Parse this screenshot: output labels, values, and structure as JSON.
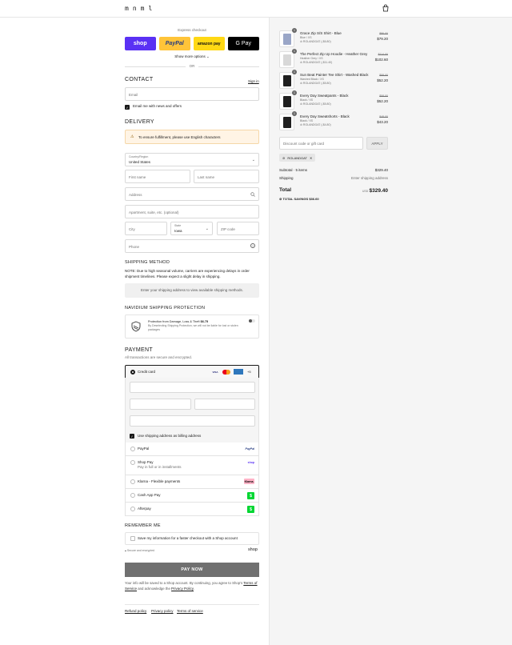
{
  "header": {
    "logo": "mnml",
    "bag_icon": "shopping-bag-icon"
  },
  "express": {
    "label": "Express checkout",
    "buttons": [
      "shop",
      "PayPal",
      "amazon pay",
      "G Pay"
    ],
    "more_options": "Show more options ⌄",
    "or": "OR"
  },
  "contact": {
    "title": "CONTACT",
    "sign_in": "Sign in",
    "email_placeholder": "Email",
    "email_news": "Email me with news and offers"
  },
  "delivery": {
    "title": "DELIVERY",
    "notice": "To ensure fulfillment, please use English characters",
    "country_label": "Country/Region",
    "country_value": "United States",
    "first_name": "First name",
    "last_name": "Last name",
    "address": "Address",
    "apartment": "Apartment, suite, etc. (optional)",
    "city": "City",
    "state_label": "State",
    "state_value": "Iowa",
    "zip": "ZIP code",
    "phone": "Phone"
  },
  "shipping": {
    "title": "SHIPPING METHOD",
    "note": "NOTE: Due to high seasonal volume, carriers are experiencing delays in order shipment timelines. Please expect a slight delay in shipping.",
    "placeholder": "Enter your shipping address to view available shipping methods."
  },
  "protection": {
    "title": "NAVIDIUM SHIPPING PROTECTION",
    "line1": "Protection from Damage, Loss & Theft",
    "price": "$6.75",
    "line2": "By Deselecting Shipping Protection, we will not be liable for lost or stolen packages"
  },
  "payment": {
    "title": "PAYMENT",
    "subtitle": "All transactions are secure and encrypted.",
    "credit_card": "Credit card",
    "card_badges": [
      "VISA",
      "MC",
      "AMEX",
      "+5"
    ],
    "billing_same": "Use shipping address as billing address",
    "methods": [
      {
        "label": "PayPal",
        "sub": "",
        "badge": "PayPal",
        "color": "#253b80"
      },
      {
        "label": "Shop Pay",
        "sub": "Pay in full or in installments",
        "badge": "shop",
        "color": "#5a31f4"
      },
      {
        "label": "Klarna - Flexible payments",
        "sub": "",
        "badge": "Klarna.",
        "color": "#ffb3c7"
      },
      {
        "label": "Cash App Pay",
        "sub": "",
        "badge": "$",
        "color": "#00d632"
      },
      {
        "label": "Afterpay",
        "sub": "",
        "badge": "$",
        "color": "#00d632"
      }
    ]
  },
  "remember": {
    "title": "REMEMBER ME",
    "save_info": "Save my information for a faster checkout with a Shop account",
    "secure": "Secure and encrypted",
    "shop": "shop"
  },
  "pay_now": "PAY NOW",
  "legal": {
    "prefix": "Your info will be saved to a Shop account. By continuing, you agree to Shop's",
    "terms": "Terms of Service",
    "middle": "and acknowledge the",
    "privacy": "Privacy Policy"
  },
  "footer_links": [
    "Refund policy",
    "Privacy policy",
    "Terms of service"
  ],
  "cart": {
    "items": [
      {
        "qty": "1",
        "name": "Grace Zip S/S Shirt - Blue",
        "variant": "Blue / XS",
        "discount": "ROLANDGAT (-$6.80)",
        "old": "$86.00",
        "price": "$79.20",
        "thumb": "#9aa6c7"
      },
      {
        "qty": "1",
        "name": "The Perfect Zip Up Hoodie - Heather Grey",
        "variant": "Heather Grey / XS",
        "discount": "ROLANDGAT (-$11.40)",
        "old": "$114.00",
        "price": "$102.60",
        "thumb": "#d8d8d8"
      },
      {
        "qty": "1",
        "name": "Sun Beat Painter Tee Shirt - Washed Black",
        "variant": "Washed Black / XS",
        "discount": "ROLANDGAT (-$5.80)",
        "old": "$58.00",
        "price": "$52.20",
        "thumb": "#1f1f1f"
      },
      {
        "qty": "1",
        "name": "Every Day Sweatpants - Black",
        "variant": "Black / XS",
        "discount": "ROLANDGAT (-$5.80)",
        "old": "$58.00",
        "price": "$52.20",
        "thumb": "#1f1f1f"
      },
      {
        "qty": "1",
        "name": "Every Day Sweatshorts - Black",
        "variant": "Black / XS",
        "discount": "ROLANDGAT (-$4.80)",
        "old": "$48.00",
        "price": "$43.20",
        "thumb": "#1f1f1f"
      }
    ],
    "discount_placeholder": "Discount code or gift card",
    "apply": "APPLY",
    "applied_code": "ROLANDGAT",
    "subtotal_label": "Subtotal · 5 items",
    "subtotal": "$329.40",
    "shipping_label": "Shipping",
    "shipping_value": "Enter shipping address",
    "total_label": "Total",
    "currency": "USD",
    "total": "$329.40",
    "savings_label": "TOTAL SAVINGS",
    "savings": "$36.60"
  }
}
